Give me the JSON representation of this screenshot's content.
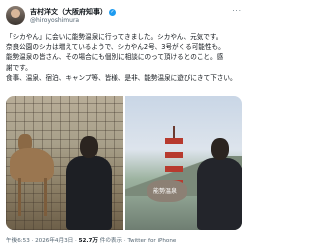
{
  "author": {
    "name": "吉村洋文（大阪府知事）",
    "handle": "@hiroyoshimura",
    "verified": true
  },
  "post": {
    "lines": [
      "「シカやん」に会いに能勢温泉に行ってきました。シカやん、元気です。",
      "奈良公園のシカは増えているようで、シカやん2号、3号がくる可能性も。",
      "能勢温泉の皆さん、その場合にも個別に相談にのって頂けるとのこと。感",
      "謝です。",
      "食事、温泉、宿泊、キャンプ等、皆様、是非、能勢温泉に遊びにきて下さい。"
    ]
  },
  "media": {
    "left_alt": "deer-and-man-photo",
    "right_alt": "pagoda-and-man-photo",
    "rock_text": "能勢温泉"
  },
  "meta": {
    "time": "午後6:53 · 2026年4月3日 · ",
    "views": "52.7万",
    "views_label": " 件の表示 · ",
    "client": "Twitter for iPhone"
  }
}
